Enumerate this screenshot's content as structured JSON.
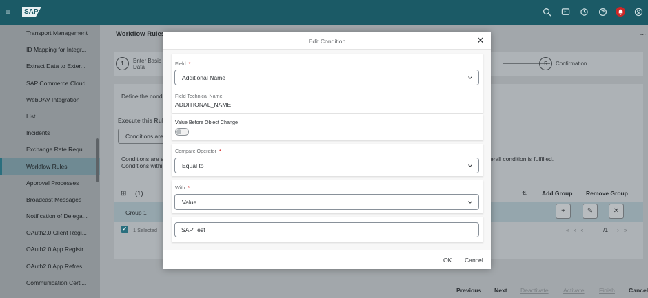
{
  "shell": {
    "menu_icon": "hamburger-icon",
    "logo_text": "SAP",
    "icons": [
      "search-icon",
      "screen-share-icon",
      "history-icon",
      "help-icon",
      "notification-icon",
      "user-icon"
    ],
    "brand_color": "#1b5a66",
    "alert_color": "#cc2727"
  },
  "nav": {
    "items": [
      {
        "label": "Transport Management",
        "active": false
      },
      {
        "label": "ID Mapping for Integr...",
        "active": false
      },
      {
        "label": "Extract Data to Exter...",
        "active": false
      },
      {
        "label": "SAP Commerce Cloud",
        "active": false
      },
      {
        "label": "WebDAV Integration",
        "active": false
      },
      {
        "label": "List",
        "active": false
      },
      {
        "label": "Incidents",
        "active": false
      },
      {
        "label": "Exchange Rate Requ...",
        "active": false
      },
      {
        "label": "Workflow Rules",
        "active": true
      },
      {
        "label": "Approval Processes",
        "active": false
      },
      {
        "label": "Broadcast Messages",
        "active": false
      },
      {
        "label": "Notification of Delega...",
        "active": false
      },
      {
        "label": "OAuth2.0 Client Regi...",
        "active": false
      },
      {
        "label": "OAuth2.0 App Registr...",
        "active": false
      },
      {
        "label": "OAuth2.0 App Refres...",
        "active": false
      },
      {
        "label": "Communication Certi...",
        "active": false
      }
    ]
  },
  "background": {
    "page_title": "Workflow Rules",
    "more": "...",
    "step1_num": "1",
    "step1_label": "Enter Basic Data",
    "step5_num": "5",
    "step5_label": "Confirmation",
    "define_text": "Define the condi",
    "execute_label": "Execute this Rul",
    "conditions_button": "Conditions are",
    "info_line1": "Conditions are s",
    "info_line2": "Conditions withi",
    "info_tail": "erall condition is fulfilled.",
    "group_count": "(1)",
    "add_group": "Add Group",
    "remove_group": "Remove Group",
    "group_name": "Group 1",
    "selected_text": "1 Selected",
    "pager_text": "/1",
    "footer": {
      "previous": "Previous",
      "next": "Next",
      "deactivate": "Deactivate",
      "activate": "Activate",
      "finish": "Finish",
      "cancel": "Cancel"
    }
  },
  "dialog": {
    "title": "Edit Condition",
    "field_label": "Field",
    "field_value": "Additional Name",
    "tech_name_label": "Field Technical Name",
    "tech_name_value": "ADDITIONAL_NAME",
    "value_before_label": "Value Before Object Change",
    "value_before_on": false,
    "compare_label": "Compare Operator",
    "compare_value": "Equal to",
    "with_label": "With",
    "with_value": "Value",
    "value_input": "SAP'Test",
    "required_mark": "*",
    "ok": "OK",
    "cancel": "Cancel"
  }
}
